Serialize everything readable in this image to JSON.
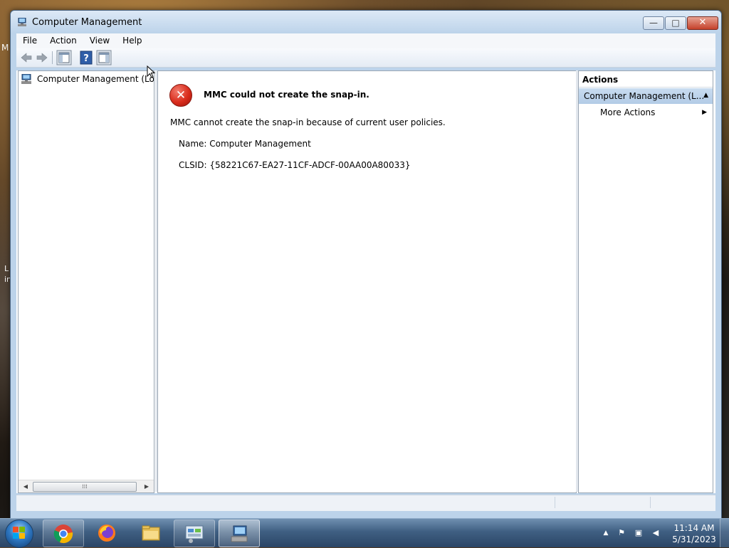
{
  "window": {
    "title": "Computer Management",
    "buttons": {
      "minimize": "—",
      "maximize": "□",
      "close": "✕"
    }
  },
  "menubar": {
    "items": [
      "File",
      "Action",
      "View",
      "Help"
    ]
  },
  "toolbar": {
    "buttons": [
      "back-icon",
      "forward-icon",
      "show-hide-console-tree-icon",
      "help-icon",
      "show-hide-action-pane-icon"
    ]
  },
  "tree": {
    "items": [
      {
        "label": "Computer Management (Local)",
        "icon": "computer-management-icon"
      }
    ]
  },
  "scrollbar": {
    "grip": "⁞⁞⁞"
  },
  "error": {
    "icon": "error-icon",
    "glyph": "✕",
    "title": "MMC could not create the snap-in.",
    "message": "MMC cannot create the snap-in because of current user policies.",
    "name_line": "Name: Computer Management",
    "clsid_line": "CLSID: {58221C67-EA27-11CF-ADCF-00AA00A80033}"
  },
  "actions": {
    "header": "Actions",
    "group": "Computer Management (L...",
    "items": [
      {
        "label": "More Actions"
      }
    ]
  },
  "taskbar": {
    "apps": [
      "chrome-icon",
      "firefox-icon",
      "file-explorer-icon",
      "control-panel-icon",
      "computer-management-icon"
    ],
    "tray": [
      "show-hidden-icons-icon",
      "action-center-flag-icon",
      "network-icon",
      "volume-muted-icon"
    ],
    "tray_glyphs": {
      "show_hidden": "▲",
      "flag": "⚑",
      "network": "▣",
      "volume": "◀"
    },
    "clock": {
      "time": "11:14 AM",
      "date": "5/31/2023"
    }
  },
  "desktop": {
    "peek_text": [
      "M",
      "L",
      "in"
    ]
  },
  "colors": {
    "titlebar": "#bcd3ea",
    "actions_group": "#b3cbe6",
    "error_red": "#d92c1c",
    "taskbar": "#3f5f82"
  }
}
